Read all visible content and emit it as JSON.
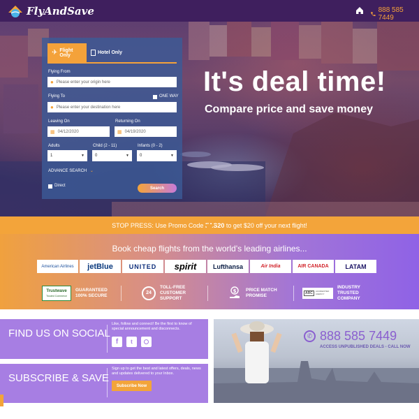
{
  "header": {
    "brand": "FlyAndSave",
    "phone": "888 585 7449"
  },
  "hero": {
    "title": "It's deal time!",
    "subtitle": "Compare price and save money"
  },
  "search": {
    "tab_flight": "Flight Only",
    "tab_hotel": "Hotel Only",
    "flying_from_label": "Flying From",
    "flying_from_placeholder": "Please enter your origin here",
    "flying_to_label": "Flying To",
    "one_way_label": "ONE WAY",
    "flying_to_placeholder": "Please enter your destination here",
    "leaving_label": "Leaving On",
    "leaving_value": "04/12/2020",
    "returning_label": "Returning On",
    "returning_value": "04/19/2020",
    "adults_label": "Adults",
    "adults_value": "1",
    "child_label": "Child (2 - 11)",
    "child_value": "0",
    "infants_label": "Infants (0 - 2)",
    "infants_value": "0",
    "advance_search": "ADVANCE SEARCH",
    "direct_label": "Direct",
    "search_button": "Search"
  },
  "promo": {
    "prefix": "STOP PRESS: Use Promo Code ",
    "code": "FAS20",
    "suffix": " to get $20 off your next flight!"
  },
  "airlines": {
    "heading": "Book cheap flights from the world's leading airlines...",
    "logos": [
      "American Airlines",
      "jetBlue",
      "UNITED",
      "spirit",
      "Lufthansa",
      "Air India",
      "AIR CANADA",
      "LATAM"
    ]
  },
  "trust": {
    "trustwave": "Trustwave",
    "trustwave_sub": "Trusted Commerce",
    "guaranteed": "GUARANTEED 100% SECURE",
    "support_badge": "24",
    "support": "TOLL-FREE CUSTOMER SUPPORT",
    "price_match": "PRICE MATCH PROMISE",
    "arc_badge": "ARC",
    "arc_sub": "ACCREDITED AGENCY",
    "industry": "INDUSTRY TRUSTED COMPANY"
  },
  "social": {
    "title": "FIND US ON SOCIAL",
    "text": "Like, follow and connect! Be the first to know of special announcement and disconnects."
  },
  "subscribe": {
    "title": "SUBSCRIBE & SAVE",
    "text": "Sign up to get the best and latest offers, deals, news and updates delivered to your Inbox.",
    "button": "Subscribe Now"
  },
  "call": {
    "phone": "888 585 7449",
    "tagline": "ACCESS UNPUBLISHED DEALS - CALL NOW"
  },
  "colors": {
    "topbar": "#3f1f5e",
    "accent_orange": "#f3a43a",
    "purple": "#a77ee3"
  }
}
